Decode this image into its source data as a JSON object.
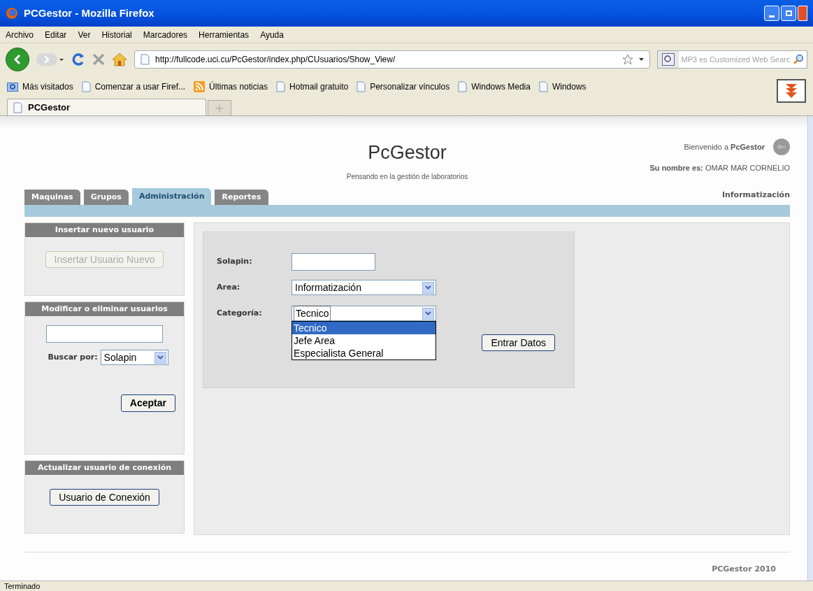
{
  "window": {
    "title": "PCGestor - Mozilla Firefox"
  },
  "menu": [
    "Archivo",
    "Editar",
    "Ver",
    "Historial",
    "Marcadores",
    "Herramientas",
    "Ayuda"
  ],
  "toolbar": {
    "url": "http://fullcode.uci.cu/PcGestor/index.php/CUsuarios/Show_View/",
    "search_placeholder": "MP3 es Customized Web Searc"
  },
  "bookmarks": [
    {
      "label": "Más visitados",
      "kind": "smart"
    },
    {
      "label": "Comenzar a usar Firef...",
      "kind": "page"
    },
    {
      "label": "Últimas noticias",
      "kind": "feed"
    },
    {
      "label": "Hotmail gratuito",
      "kind": "page"
    },
    {
      "label": "Personalizar vínculos",
      "kind": "page"
    },
    {
      "label": "Windows Media",
      "kind": "page"
    },
    {
      "label": "Windows",
      "kind": "page"
    }
  ],
  "browser_tabs": [
    {
      "label": "PCGestor",
      "selected": true
    }
  ],
  "page": {
    "title": "PcGestor",
    "subtitle": "Pensando en la gestión de laboratorios",
    "welcome": "Bienvenido a **PcGestor**",
    "user": "**Su nombre es:** OMAR MAR CORNELIO",
    "area": "Informatización",
    "nav_tabs": [
      {
        "label": "Maquinas",
        "selected": false
      },
      {
        "label": "Grupos",
        "selected": false
      },
      {
        "label": "Administración",
        "selected": true
      },
      {
        "label": "Reportes",
        "selected": false
      }
    ],
    "panels": [
      {
        "title": "Insertar nuevo usuario",
        "kind": "button",
        "button": {
          "label": "Insertar Usuario Nuevo",
          "disabled": true
        }
      },
      {
        "title": "Modificar o eliminar usuarios",
        "kind": "search",
        "search_label": "Buscar por:",
        "search_by": "Solapin",
        "button": {
          "label": "Aceptar",
          "disabled": false
        }
      },
      {
        "title": "Actualizar usuario de conexión",
        "kind": "button",
        "button": {
          "label": "Usuario de Conexión",
          "disabled": false
        }
      }
    ],
    "form": {
      "fields": [
        {
          "label": "Solapin:",
          "kind": "text"
        },
        {
          "label": "Area:",
          "kind": "select",
          "value": "Informatización"
        },
        {
          "label": "Categoría:",
          "kind": "select",
          "value": "Tecnico",
          "open": true
        }
      ],
      "options": [
        {
          "label": "Tecnico",
          "selected": true
        },
        {
          "label": "Jefe Area",
          "selected": false
        },
        {
          "label": "Especialista General",
          "selected": false
        }
      ],
      "submit": "Entrar Datos"
    },
    "footer": "PCGestor 2010"
  },
  "status_bar": "Terminado"
}
